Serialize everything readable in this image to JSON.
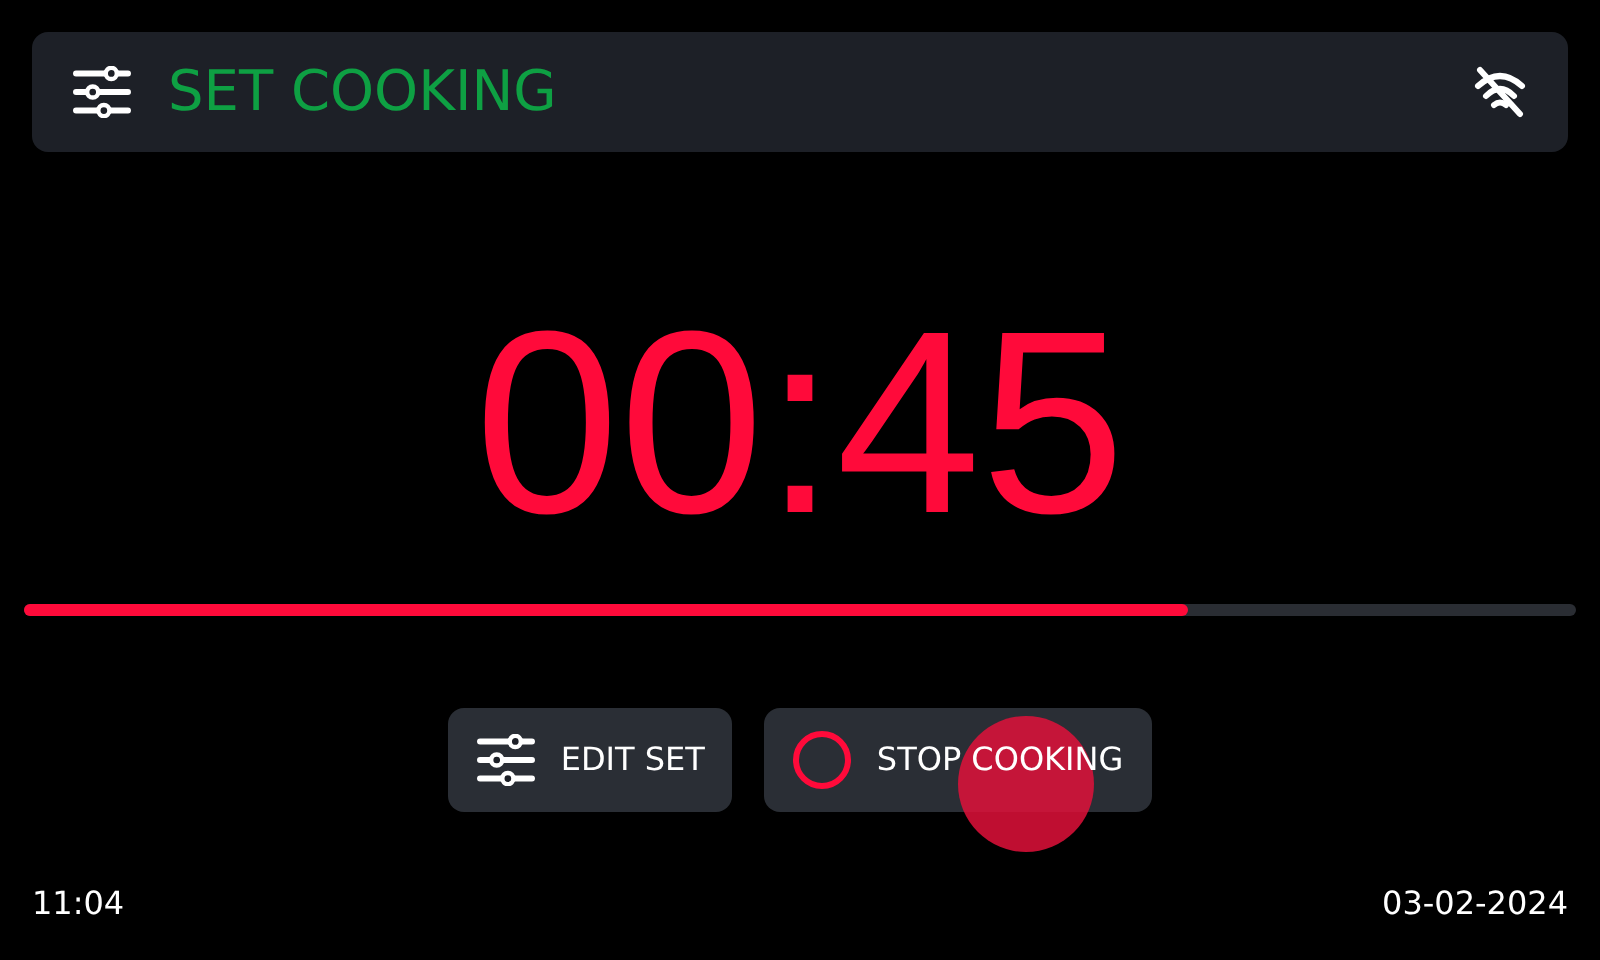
{
  "header": {
    "title": "SET COOKING"
  },
  "timer": {
    "value": "00:45"
  },
  "progress": {
    "level": 0.75
  },
  "buttons": [
    {
      "kind": "settings",
      "label": "EDIT SET"
    },
    {
      "kind": "stop",
      "label": "STOP COOKING"
    }
  ],
  "status_bar": {
    "time": "11:04",
    "date": "03-02-2024"
  }
}
